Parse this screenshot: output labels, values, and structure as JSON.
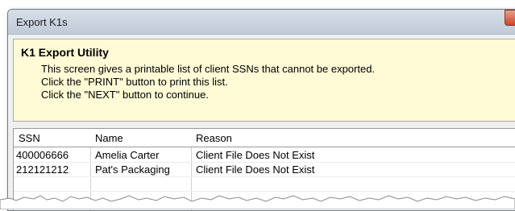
{
  "window": {
    "title": "Export K1s"
  },
  "info": {
    "heading": "K1 Export Utility",
    "lines": [
      "This screen gives a printable list of client SSNs that cannot be exported.",
      "Click the \"PRINT\" button to print this list.",
      "Click the \"NEXT\" button to continue."
    ]
  },
  "table": {
    "columns": [
      "SSN",
      "Name",
      "Reason"
    ],
    "rows": [
      [
        "400006666",
        "Amelia Carter",
        "Client File Does Not Exist"
      ],
      [
        "212121212",
        "Pat's Packaging",
        "Client File Does Not Exist"
      ]
    ]
  },
  "icons": {
    "close": "close-icon"
  },
  "colors": {
    "info_background": "#fffbd6",
    "close_button": "#c9462c"
  }
}
